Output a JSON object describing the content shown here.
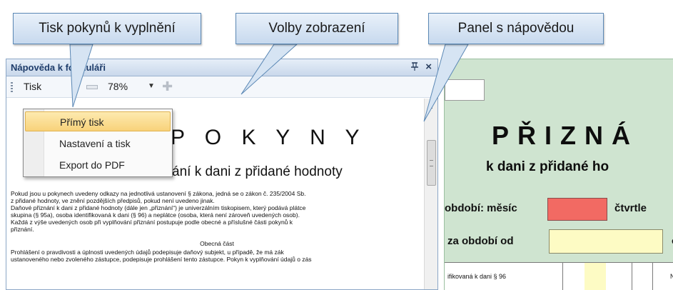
{
  "callouts": {
    "print_instructions": "Tisk pokynů k vyplnění",
    "view_options": "Volby zobrazení",
    "help_panel": "Panel s nápovědou"
  },
  "help_panel": {
    "title": "Nápověda k formuláři",
    "pin_icon": "pin-icon",
    "close_glyph": "×",
    "toolbar": {
      "print_label": "Tisk",
      "zoom_value": "78%"
    },
    "print_menu": {
      "items": [
        "Přímý tisk",
        "Nastavení a tisk",
        "Export do PDF"
      ],
      "selected": "Přímý tisk"
    },
    "document": {
      "heading": "P O K Y N Y",
      "subheading": "ání k dani z přidané hodnoty",
      "paragraph_lines": [
        "Pokud jsou u pokynech uvedeny odkazy na jednotlivá ustanovení § zákona, jedná se o zákon č. 235/2004 Sb.",
        "z přidané hodnoty, ve znění pozdějších předpisů, pokud není uvedeno jinak.",
        "Daňové přiznání k dani z přidané hodnoty (dále jen „přiznání“) je univerzálním tiskopisem, který podává plátce",
        "skupina (§ 95a), osoba identifikovaná k dani (§ 96) a neplátce (osoba, která není zároveň uvedených osob).",
        "Každá z výše uvedených osob při vyplňování přiznání postupuje podle obecné a příslušné části pokynů k",
        "přiznání."
      ],
      "section_title": "Obecná část",
      "section_lines": [
        "Prohlášení o pravdivosti a úplnosti uvedených údajů podepisuje daňový subjekt, u případě, že má zák",
        "ustanoveného nebo zvoleného zástupce, podepisuje prohlášení tento zástupce. Pokyn k vyplňování údajů o zás"
      ]
    }
  },
  "form": {
    "title": "PŘIZNÁ",
    "subtitle": "k dani z přidané ho",
    "label_period": "období: měsíc",
    "label_quarter": "čtvrtle",
    "label_from": "za období od",
    "label_o": "o",
    "table_cell_a": "ifikovaná k dani § 96",
    "table_cell_c": "N"
  }
}
